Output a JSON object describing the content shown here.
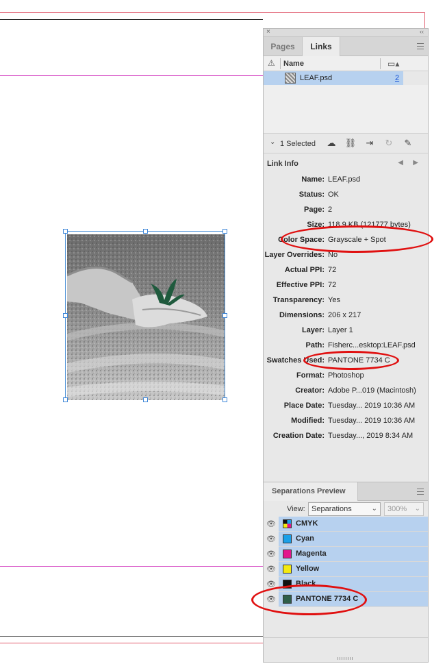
{
  "panel": {
    "close_glyph": "×",
    "collapse_glyph": "‹‹",
    "tabs": [
      {
        "label": "Pages",
        "active": false
      },
      {
        "label": "Links",
        "active": true
      }
    ],
    "links_header": {
      "name_col": "Name"
    },
    "links": [
      {
        "name": "LEAF.psd",
        "page": "2"
      }
    ],
    "toolbar": {
      "selected_text": "1 Selected"
    },
    "link_info": {
      "title": "Link Info",
      "rows": [
        {
          "label": "Name:",
          "value": "LEAF.psd"
        },
        {
          "label": "Status:",
          "value": "OK"
        },
        {
          "label": "Page:",
          "value": "2"
        },
        {
          "label": "Size:",
          "value": "118.9 KB (121777 bytes)"
        },
        {
          "label": "Color Space:",
          "value": "Grayscale + Spot"
        },
        {
          "label": "Layer Overrides:",
          "value": "No"
        },
        {
          "label": "Actual PPI:",
          "value": "72"
        },
        {
          "label": "Effective PPI:",
          "value": "72"
        },
        {
          "label": "Transparency:",
          "value": "Yes"
        },
        {
          "label": "Dimensions:",
          "value": "206 x 217"
        },
        {
          "label": "Layer:",
          "value": "Layer 1"
        },
        {
          "label": "Path:",
          "value": "Fisherc...esktop:LEAF.psd"
        },
        {
          "label": "Swatches Used:",
          "value": "PANTONE 7734 C"
        },
        {
          "label": "Format:",
          "value": "Photoshop"
        },
        {
          "label": "Creator:",
          "value": "Adobe P...019 (Macintosh)"
        },
        {
          "label": "Place Date:",
          "value": "Tuesday... 2019 10:36 AM"
        },
        {
          "label": "Modified:",
          "value": "Tuesday... 2019 10:36 AM"
        },
        {
          "label": "Creation Date:",
          "value": "Tuesday..., 2019 8:34 AM"
        }
      ]
    },
    "separations": {
      "title": "Separations Preview",
      "view_label": "View:",
      "view_value": "Separations",
      "zoom_value": "300%",
      "plates": [
        {
          "name": "CMYK",
          "color": "#1a1a1a",
          "icon": "cmyk-icon"
        },
        {
          "name": "Cyan",
          "color": "#1aa0e8"
        },
        {
          "name": "Magenta",
          "color": "#e2168c"
        },
        {
          "name": "Yellow",
          "color": "#f4ea12"
        },
        {
          "name": "Black",
          "color": "#111111"
        },
        {
          "name": "PANTONE 7734 C",
          "color": "#2e5e49"
        }
      ]
    }
  }
}
